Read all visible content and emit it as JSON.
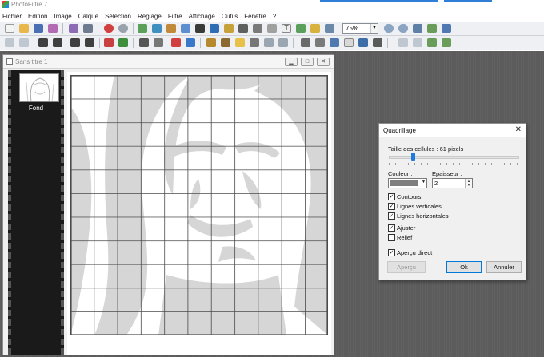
{
  "app": {
    "title": "PhotoFiltre 7"
  },
  "menu": {
    "items": [
      "Fichier",
      "Edition",
      "Image",
      "Calque",
      "Sélection",
      "Réglage",
      "Filtre",
      "Affichage",
      "Outils",
      "Fenêtre",
      "?"
    ]
  },
  "toolbar": {
    "zoom_value": "75%"
  },
  "document": {
    "title": "Sans titre 1",
    "layer_name": "Fond"
  },
  "dialog": {
    "title": "Quadrillage",
    "cell_size_label": "Taille des cellules : 61 pixels",
    "cell_size_slider_fraction": 0.19,
    "color_label": "Couleur :",
    "color_value": "#7f7f7f",
    "thickness_label": "Epaisseur :",
    "thickness_value": "2",
    "checkboxes": [
      {
        "label": "Contours",
        "checked": true
      },
      {
        "label": "Lignes verticales",
        "checked": true
      },
      {
        "label": "Lignes horizontales",
        "checked": true
      },
      {
        "label": "Ajuster",
        "checked": true
      },
      {
        "label": "Relief",
        "checked": false
      },
      {
        "label": "Aperçu direct",
        "checked": true
      }
    ],
    "buttons": {
      "preview": "Aperçu",
      "ok": "Ok",
      "cancel": "Annuler"
    }
  }
}
